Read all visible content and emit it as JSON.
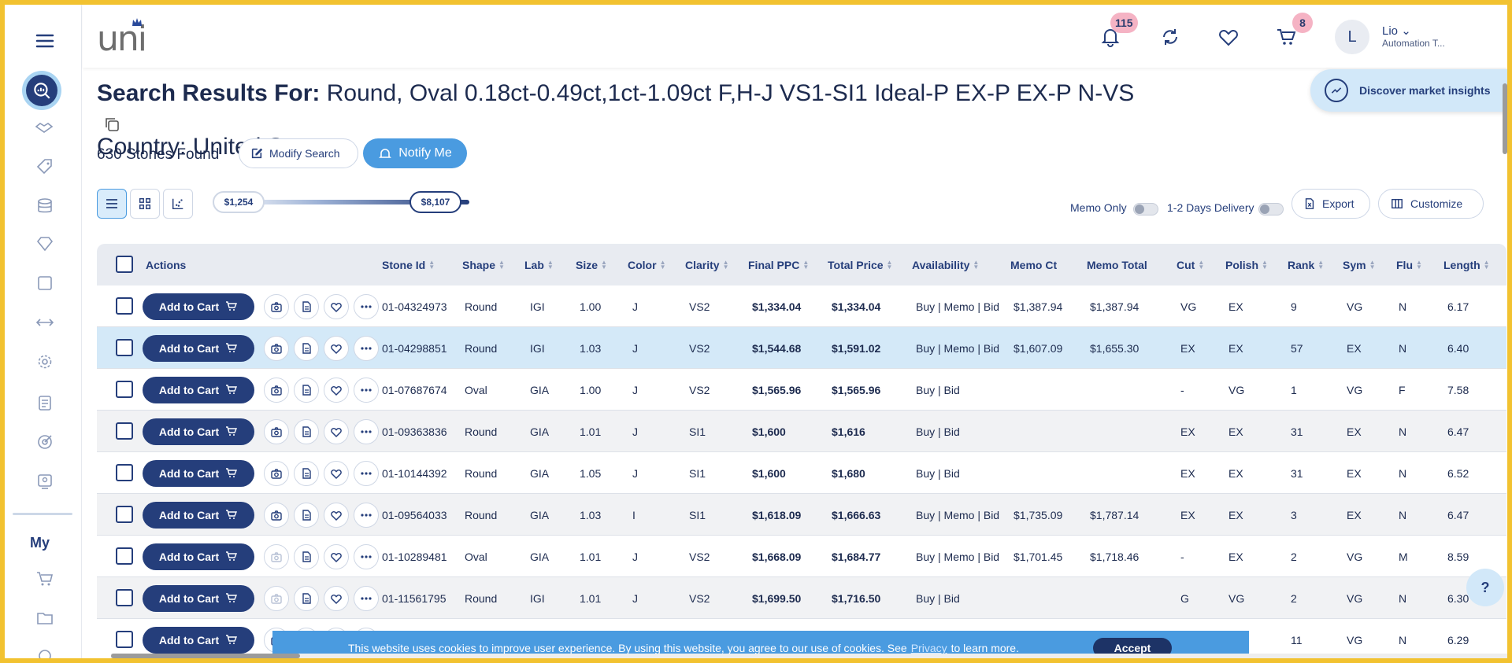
{
  "header": {
    "logo_text": "uni",
    "notifications_count": "115",
    "cart_count": "8",
    "avatar_initial": "L",
    "user_name": "Lio",
    "user_role": "Automation T..."
  },
  "sidebar": {
    "my_label": "My"
  },
  "search": {
    "title_prefix": "Search Results For:",
    "title_criteria": "Round, Oval 0.18ct-0.49ct,1ct-1.09ct F,H-J VS1-SI1 Ideal-P EX-P EX-P N-VS",
    "title_country": "Country: United States",
    "stones_found": "630 Stones Found",
    "modify_label": "Modify Search",
    "notify_label": "Notify Me",
    "insights_label": "Discover market insights"
  },
  "toolbar": {
    "price_min": "$1,254",
    "price_max": "$8,107",
    "memo_only_label": "Memo Only",
    "delivery_label": "1-2 Days Delivery",
    "export_label": "Export",
    "customize_label": "Customize"
  },
  "table": {
    "add_to_cart_label": "Add to Cart",
    "columns": [
      "Actions",
      "Stone Id",
      "Shape",
      "Lab",
      "Size",
      "Color",
      "Clarity",
      "Final PPC",
      "Total Price",
      "Availability",
      "Memo Ct",
      "Memo Total",
      "Cut",
      "Polish",
      "Rank",
      "Sym",
      "Flu",
      "Length"
    ],
    "rows": [
      {
        "id": "01-04324973",
        "shape": "Round",
        "lab": "IGI",
        "size": "1.00",
        "color": "J",
        "clarity": "VS2",
        "ppc": "$1,334.04",
        "total": "$1,334.04",
        "avail": "Buy | Memo | Bid",
        "memo_ct": "$1,387.94",
        "memo_total": "$1,387.94",
        "cut": "VG",
        "polish": "EX",
        "rank": "9",
        "sym": "VG",
        "flu": "N",
        "length": "6.17"
      },
      {
        "id": "01-04298851",
        "shape": "Round",
        "lab": "IGI",
        "size": "1.03",
        "color": "J",
        "clarity": "VS2",
        "ppc": "$1,544.68",
        "total": "$1,591.02",
        "avail": "Buy | Memo | Bid",
        "memo_ct": "$1,607.09",
        "memo_total": "$1,655.30",
        "cut": "EX",
        "polish": "EX",
        "rank": "57",
        "sym": "EX",
        "flu": "N",
        "length": "6.40"
      },
      {
        "id": "01-07687674",
        "shape": "Oval",
        "lab": "GIA",
        "size": "1.00",
        "color": "J",
        "clarity": "VS2",
        "ppc": "$1,565.96",
        "total": "$1,565.96",
        "avail": "Buy | Bid",
        "memo_ct": "",
        "memo_total": "",
        "cut": "-",
        "polish": "VG",
        "rank": "1",
        "sym": "VG",
        "flu": "F",
        "length": "7.58"
      },
      {
        "id": "01-09363836",
        "shape": "Round",
        "lab": "GIA",
        "size": "1.01",
        "color": "J",
        "clarity": "SI1",
        "ppc": "$1,600",
        "total": "$1,616",
        "avail": "Buy | Bid",
        "memo_ct": "",
        "memo_total": "",
        "cut": "EX",
        "polish": "EX",
        "rank": "31",
        "sym": "EX",
        "flu": "N",
        "length": "6.47"
      },
      {
        "id": "01-10144392",
        "shape": "Round",
        "lab": "GIA",
        "size": "1.05",
        "color": "J",
        "clarity": "SI1",
        "ppc": "$1,600",
        "total": "$1,680",
        "avail": "Buy | Bid",
        "memo_ct": "",
        "memo_total": "",
        "cut": "EX",
        "polish": "EX",
        "rank": "31",
        "sym": "EX",
        "flu": "N",
        "length": "6.52"
      },
      {
        "id": "01-09564033",
        "shape": "Round",
        "lab": "GIA",
        "size": "1.03",
        "color": "I",
        "clarity": "SI1",
        "ppc": "$1,618.09",
        "total": "$1,666.63",
        "avail": "Buy | Memo | Bid",
        "memo_ct": "$1,735.09",
        "memo_total": "$1,787.14",
        "cut": "EX",
        "polish": "EX",
        "rank": "3",
        "sym": "EX",
        "flu": "N",
        "length": "6.47"
      },
      {
        "id": "01-10289481",
        "shape": "Oval",
        "lab": "GIA",
        "size": "1.01",
        "color": "J",
        "clarity": "VS2",
        "ppc": "$1,668.09",
        "total": "$1,684.77",
        "avail": "Buy | Memo | Bid",
        "memo_ct": "$1,701.45",
        "memo_total": "$1,718.46",
        "cut": "-",
        "polish": "EX",
        "rank": "2",
        "sym": "VG",
        "flu": "M",
        "length": "8.59"
      },
      {
        "id": "01-11561795",
        "shape": "Round",
        "lab": "IGI",
        "size": "1.01",
        "color": "J",
        "clarity": "VS2",
        "ppc": "$1,699.50",
        "total": "$1,716.50",
        "avail": "Buy | Bid",
        "memo_ct": "",
        "memo_total": "",
        "cut": "G",
        "polish": "VG",
        "rank": "2",
        "sym": "VG",
        "flu": "N",
        "length": "6.30"
      },
      {
        "id": "",
        "shape": "",
        "lab": "",
        "size": "",
        "color": "",
        "clarity": "",
        "ppc": "",
        "total": "",
        "avail": "",
        "memo_ct": "",
        "memo_total": "",
        "cut": "",
        "polish": "",
        "rank": "11",
        "sym": "VG",
        "flu": "N",
        "length": "6.29"
      }
    ]
  },
  "cookie": {
    "text_before": "This website uses cookies to improve user experience. By using this website, you agree to our use of cookies. See",
    "link": "Privacy",
    "text_after": "to learn more.",
    "accept_label": "Accept"
  },
  "help_label": "?",
  "colors": {
    "primary": "#253e7b",
    "accent": "#4a9be0",
    "highlight_row": "#d4e9f8",
    "badge": "#f5b3c4",
    "frame": "#f2c230"
  }
}
